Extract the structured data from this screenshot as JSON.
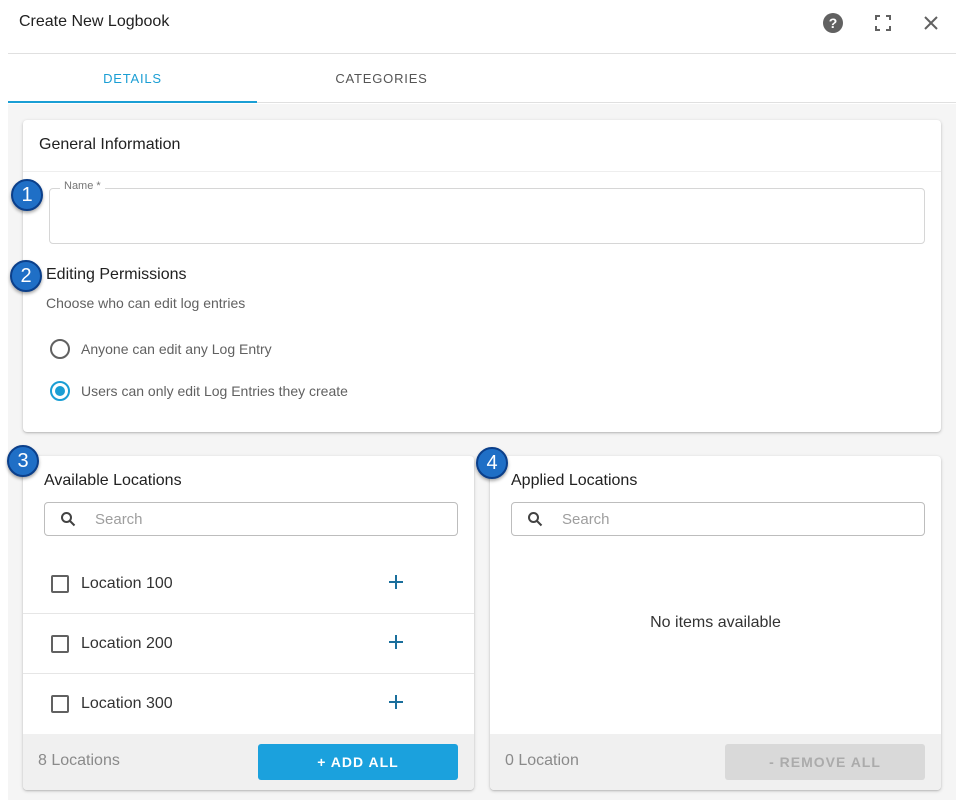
{
  "dialog": {
    "title": "Create New Logbook"
  },
  "header_icons": {
    "help": "help-circle-icon",
    "fullscreen": "fullscreen-icon",
    "close": "close-icon"
  },
  "tabs": [
    {
      "label": "DETAILS",
      "active": true
    },
    {
      "label": "CATEGORIES",
      "active": false
    }
  ],
  "general": {
    "title": "General Information",
    "name_field": {
      "label": "Name *",
      "value": ""
    },
    "permissions": {
      "title": "Editing Permissions",
      "subtitle": "Choose who can edit log entries",
      "options": [
        {
          "label": "Anyone can edit any Log Entry",
          "selected": false
        },
        {
          "label": "Users can only edit Log Entries they create",
          "selected": true
        }
      ]
    }
  },
  "available": {
    "title": "Available Locations",
    "search_placeholder": "Search",
    "items": [
      {
        "label": "Location 100",
        "checked": false
      },
      {
        "label": "Location 200",
        "checked": false
      },
      {
        "label": "Location 300",
        "checked": false
      }
    ],
    "count": "8 Locations",
    "add_all_label": "+ ADD ALL"
  },
  "applied": {
    "title": "Applied Locations",
    "search_placeholder": "Search",
    "empty_text": "No items available",
    "count": "0 Location",
    "remove_all_label": "- REMOVE ALL"
  },
  "steps": [
    "1",
    "2",
    "3",
    "4"
  ],
  "colors": {
    "accent": "#1a9ed4",
    "badge": "#1f6fc6",
    "disabled": "#d9d9d9"
  }
}
